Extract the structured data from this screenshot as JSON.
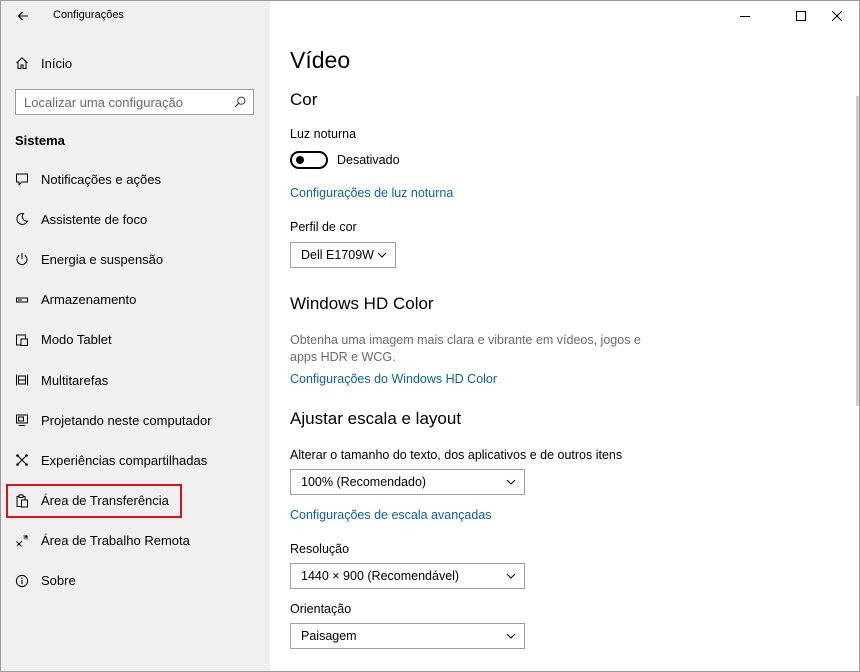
{
  "window": {
    "title": "Configurações",
    "controls": [
      "minimize-icon",
      "maximize-icon",
      "close-icon"
    ]
  },
  "sidebar": {
    "home": {
      "label": "Início",
      "icon": "home-icon"
    },
    "search": {
      "placeholder": "Localizar uma configuração",
      "icon": "search-icon"
    },
    "section": "Sistema",
    "items": [
      {
        "label": "Notificações e ações",
        "icon": "notification-icon"
      },
      {
        "label": "Assistente de foco",
        "icon": "moon-icon"
      },
      {
        "label": "Energia e suspensão",
        "icon": "power-icon"
      },
      {
        "label": "Armazenamento",
        "icon": "storage-icon"
      },
      {
        "label": "Modo Tablet",
        "icon": "tablet-icon"
      },
      {
        "label": "Multitarefas",
        "icon": "multitask-icon"
      },
      {
        "label": "Projetando neste computador",
        "icon": "project-icon"
      },
      {
        "label": "Experiências compartilhadas",
        "icon": "share-icon"
      },
      {
        "label": "Área de Transferência",
        "icon": "clipboard-icon",
        "highlighted": true,
        "highlight_color": "#d7141c"
      },
      {
        "label": "Área de Trabalho Remota",
        "icon": "remote-icon"
      },
      {
        "label": "Sobre",
        "icon": "info-icon"
      }
    ]
  },
  "main": {
    "title": "Vídeo",
    "color_section": {
      "heading": "Cor",
      "night_light_label": "Luz noturna",
      "night_light_state": "Desativado",
      "night_light_link": "Configurações de luz noturna",
      "profile_label": "Perfil de cor",
      "profile_value": "Dell E1709W"
    },
    "hd_section": {
      "heading": "Windows HD Color",
      "description": "Obtenha uma imagem mais clara e vibrante em vídeos, jogos e apps HDR e WCG.",
      "link": "Configurações do Windows HD Color"
    },
    "scale_section": {
      "heading": "Ajustar escala e layout",
      "size_label": "Alterar o tamanho do texto, dos aplicativos e de outros itens",
      "size_value": "100% (Recomendado)",
      "advanced_link": "Configurações de escala avançadas",
      "resolution_label": "Resolução",
      "resolution_value": "1440 × 900 (Recomendável)",
      "orientation_label": "Orientação",
      "orientation_value": "Paisagem"
    }
  },
  "colors": {
    "accent_link": "#0a63a8",
    "sidebar_bg": "#f0f0f0",
    "highlight": "#d7141c"
  }
}
